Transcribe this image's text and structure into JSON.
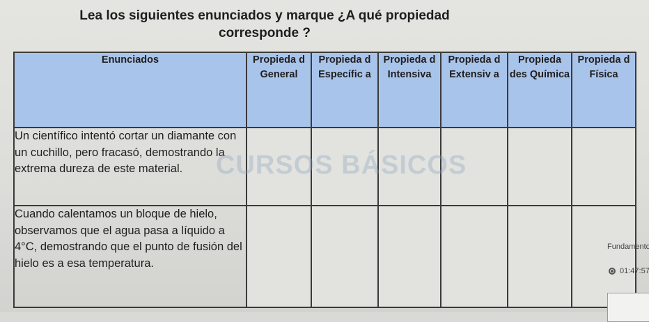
{
  "prompt": {
    "line1": "Lea los siguientes enunciados y marque ¿A qué propiedad",
    "line2": "corresponde ?"
  },
  "table": {
    "headers": [
      "Enunciados",
      "Propieda d General",
      "Propieda d Específic a",
      "Propieda d Intensiva",
      "Propieda d Extensiv a",
      "Propieda des Química",
      "Propieda d Física"
    ],
    "rows": [
      "Un científico intentó cortar un diamante con un cuchillo, pero fracasó, demostrando la extrema dureza de este material.",
      "Cuando calentamos un bloque de hielo, observamos que el agua pasa a líquido a 4°C, demostrando que el punto de fusión del hielo es a esa temperatura."
    ]
  },
  "watermark": "CURSOS BÁSICOS",
  "overlay": {
    "label": "Fundamento",
    "time": "01:47:57"
  }
}
